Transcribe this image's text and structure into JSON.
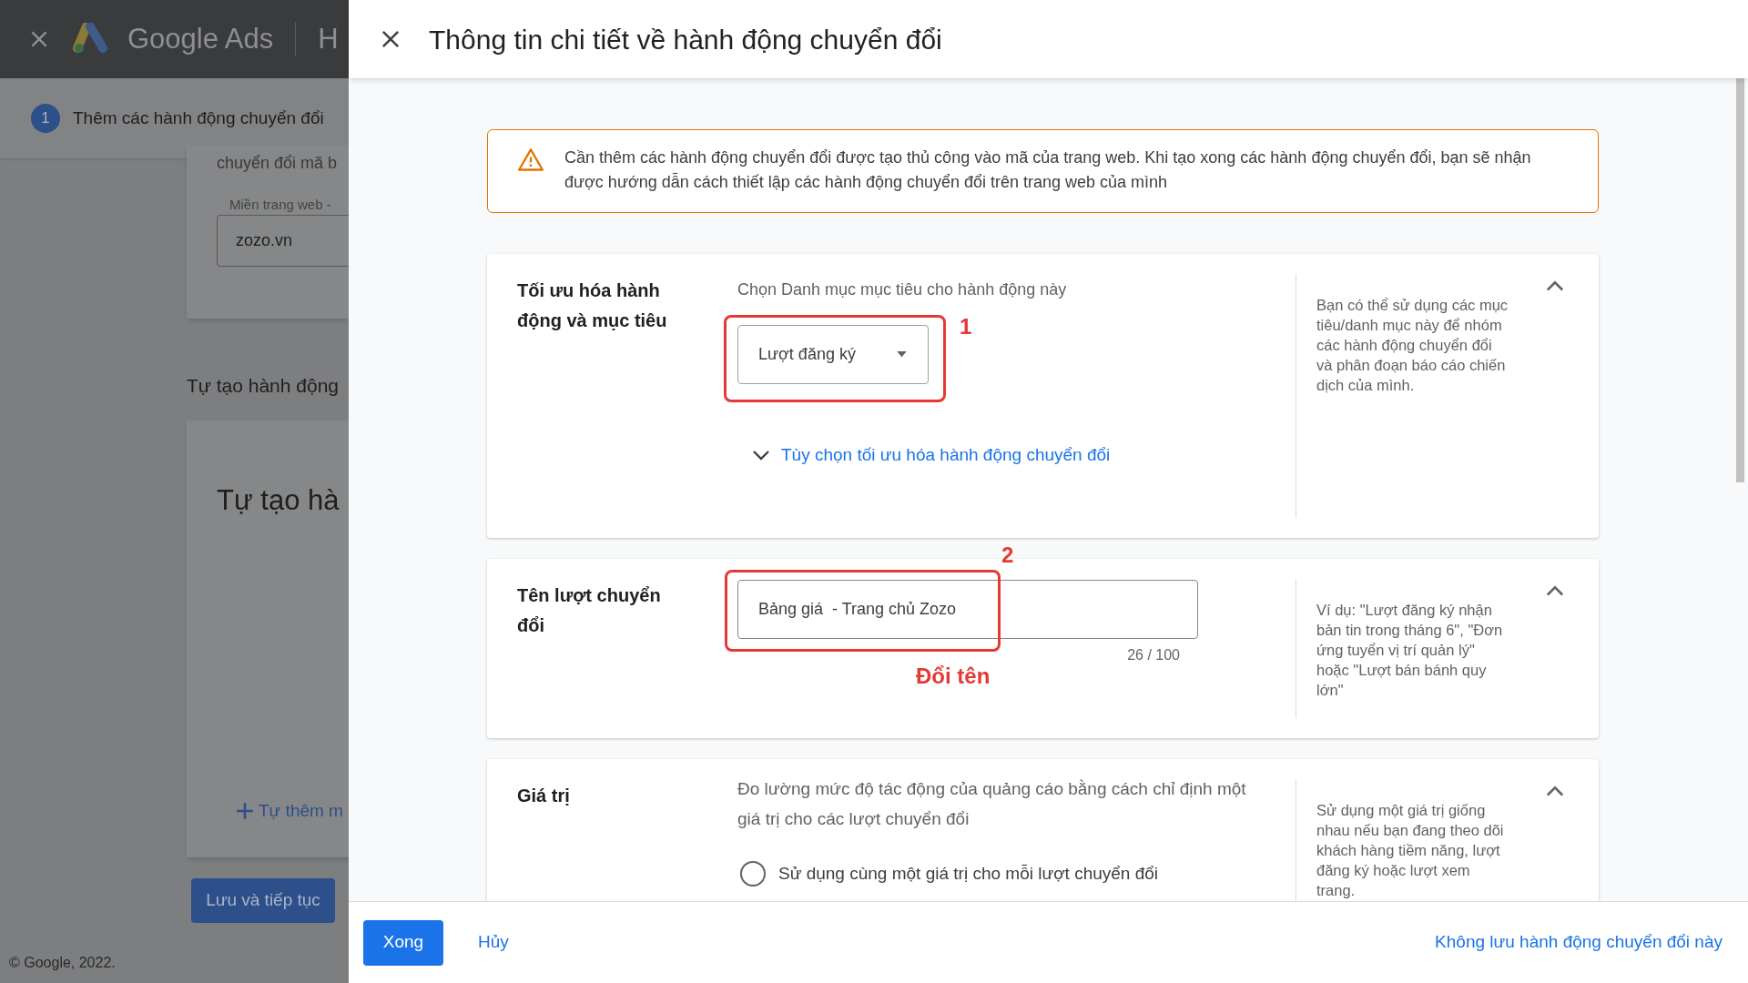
{
  "backdrop": {
    "app_title": "Google Ads",
    "header_tab": "H",
    "step": {
      "number": "1",
      "label": "Thêm các hành động chuyển đổi"
    },
    "cut_text": "chuyển đổi mã b",
    "domain_field": {
      "label": "Miền trang web -",
      "value": "zozo.vn"
    },
    "section_heading": "Tự tạo hành động",
    "card_title": "Tự tạo hà",
    "add_link": "Tự thêm m",
    "save_button": "Lưu và tiếp tục",
    "footer": "© Google, 2022."
  },
  "panel": {
    "title": "Thông tin chi tiết về hành động chuyển đổi",
    "warning": "Cần thêm các hành động chuyển đổi được tạo thủ công vào mã của trang web. Khi tạo xong các hành động chuyển đổi, bạn sẽ nhận được hướng dẫn cách thiết lập các hành động chuyển đổi trên trang web của mình",
    "sections": [
      {
        "kind": "dropdown",
        "label": "Tối ưu hóa hành động và mục tiêu",
        "expanded": true,
        "hint": "Chọn Danh mục mục tiêu cho hành động này",
        "value": "Lượt đăng ký",
        "link": "Tùy chọn tối ưu hóa hành động chuyển đổi",
        "annotation": {
          "number": "1"
        },
        "help": "Bạn có thể sử dụng các mục tiêu/danh mục này để nhóm các hành động chuyển đổi và phân đoạn báo cáo chiến dịch của mình."
      },
      {
        "kind": "text",
        "label": "Tên lượt chuyển đổi",
        "expanded": true,
        "value": "Bảng giá  - Trang chủ Zozo",
        "counter": "26 / 100",
        "annotation": {
          "number": "2",
          "note": "Đổi tên"
        },
        "help": "Ví dụ: \"Lượt đăng ký nhận bản tin trong tháng 6\", \"Đơn ứng tuyển vị trí quản lý\" hoặc \"Lượt bán bánh quy lớn\""
      },
      {
        "kind": "radio",
        "label": "Giá trị",
        "expanded": true,
        "description": "Đo lường mức độ tác động của quảng cáo bằng cách chỉ định một giá trị cho các lượt chuyển đổi",
        "options": [
          {
            "label": "Sử dụng cùng một giá trị cho mỗi lượt chuyển đổi",
            "selected": false
          }
        ],
        "help": "Sử dụng một giá trị giống nhau nếu bạn đang theo dõi khách hàng tiềm năng, lượt đăng ký hoặc lượt xem trang."
      }
    ],
    "footer": {
      "done": "Xong",
      "cancel": "Hủy",
      "discard": "Không lưu hành động chuyển đổi này"
    }
  }
}
